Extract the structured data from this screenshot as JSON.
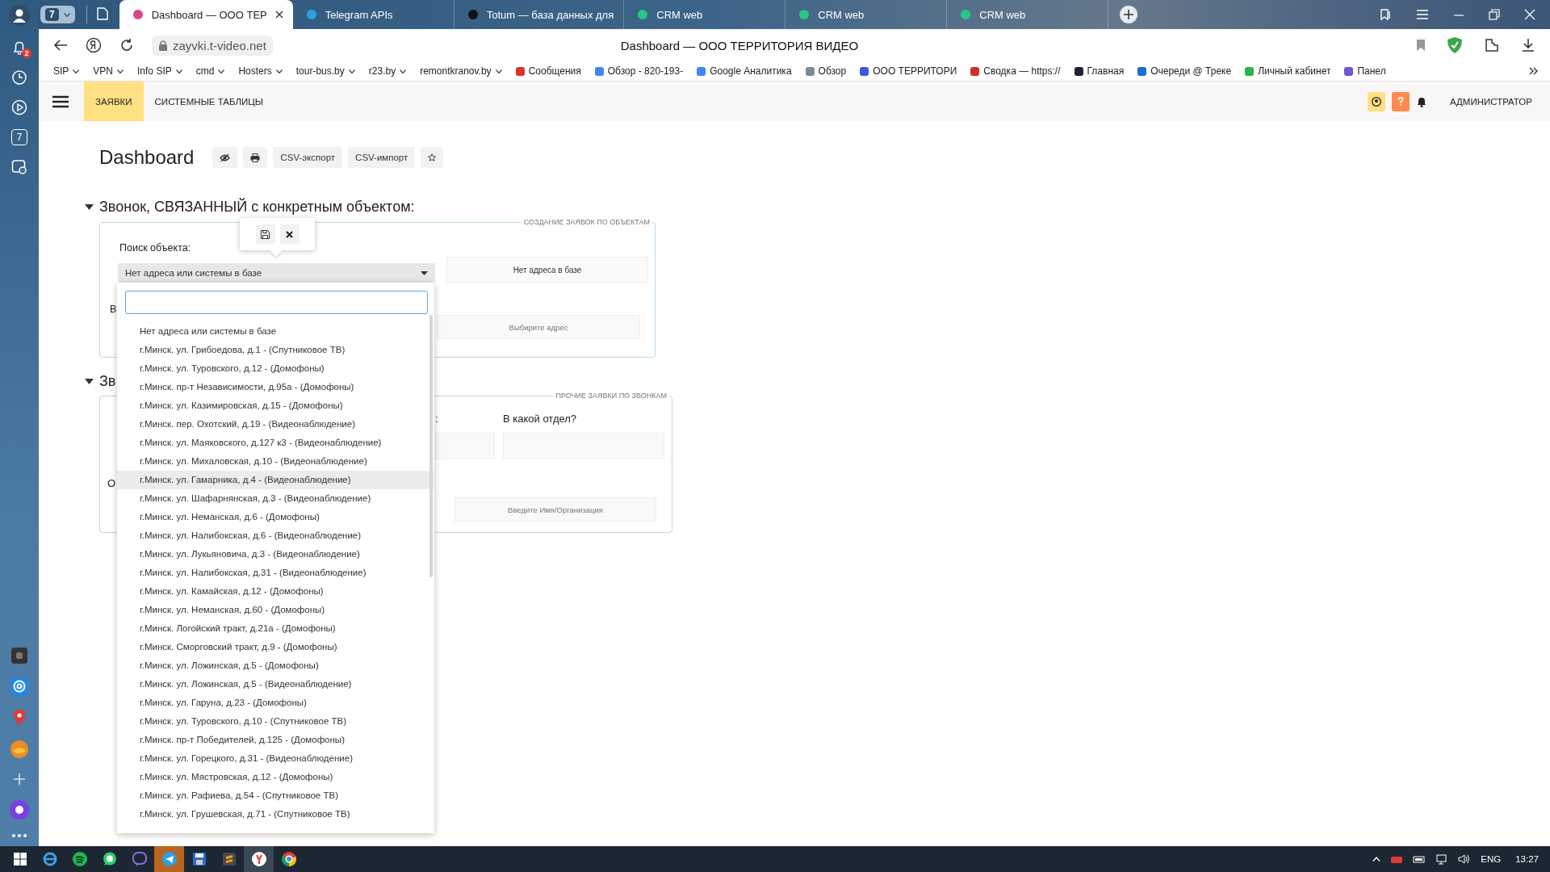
{
  "browser": {
    "tab_count": "7",
    "tabs": [
      {
        "title": "Dashboard — ООО ТЕР",
        "selected": true,
        "color": "#d9458f"
      },
      {
        "title": "Telegram APIs",
        "selected": false,
        "color": "#2aa3e0"
      },
      {
        "title": "Totum — база данных для",
        "selected": false,
        "color": "#111111"
      },
      {
        "title": "CRM web",
        "selected": false,
        "color": "#29c785"
      },
      {
        "title": "CRM web",
        "selected": false,
        "color": "#29c785"
      },
      {
        "title": "CRM web",
        "selected": false,
        "color": "#29c785"
      }
    ],
    "url": "zayvki.t-video.net",
    "page_title": "Dashboard — ООО ТЕРРИТОРИЯ ВИДЕО",
    "bookmarks": [
      {
        "label": "SIP",
        "kind": "folder"
      },
      {
        "label": "VPN",
        "kind": "folder"
      },
      {
        "label": "Info SIP",
        "kind": "folder"
      },
      {
        "label": "cmd",
        "kind": "folder"
      },
      {
        "label": "Hosters",
        "kind": "folder"
      },
      {
        "label": "tour-bus.by",
        "kind": "folder"
      },
      {
        "label": "r23.by",
        "kind": "folder"
      },
      {
        "label": "remontkranov.by",
        "kind": "folder"
      },
      {
        "label": "Сообщения",
        "kind": "link",
        "color": "#d8342c"
      },
      {
        "label": "Обзор - 820-193-",
        "kind": "link",
        "color": "#4285f4"
      },
      {
        "label": "Google Аналитика",
        "kind": "link",
        "color": "#4285f4"
      },
      {
        "label": "Обзор",
        "kind": "link",
        "color": "#7a8a9a"
      },
      {
        "label": "ООО ТЕРРИТОРИ",
        "kind": "link",
        "color": "#3b5bd6"
      },
      {
        "label": "Сводка — https://",
        "kind": "link",
        "color": "#c8332b"
      },
      {
        "label": "Главная",
        "kind": "link",
        "color": "#222233"
      },
      {
        "label": "Очереди @ Треке",
        "kind": "link",
        "color": "#1a6fd6"
      },
      {
        "label": "Личный кабинет",
        "kind": "link",
        "color": "#2bb24c"
      },
      {
        "label": "Панел",
        "kind": "link",
        "color": "#6a5acd"
      }
    ]
  },
  "sidebar": {
    "notifications": "2",
    "calendar_day": "7"
  },
  "app": {
    "nav": [
      {
        "label": "ЗАЯВКИ",
        "selected": true
      },
      {
        "label": "СИСТЕМНЫЕ ТАБЛИЦЫ",
        "selected": false
      }
    ],
    "user": "АДМИНИСТРАТОР"
  },
  "page": {
    "title": "Dashboard",
    "toolbar": [
      "CSV-экспорт",
      "CSV-импорт"
    ]
  },
  "section_1": {
    "heading": "Звонок, СВЯЗАННЫЙ с конкретным объектом:",
    "expanded": true,
    "legend": "СОЗДАНИЕ ЗАЯВОК ПО ОБЪЕКТАМ",
    "search_label": "Поиск объекта:",
    "select_value": "Нет адреса или системы в базе",
    "no_address_button": "Нет адреса в базе",
    "label_2": "В",
    "address_field": {
      "placeholder": "Выбирите адрес"
    }
  },
  "section_2": {
    "heading": "Зв",
    "expanded": true,
    "legend": "ПРОЧИЕ ЗАЯВКИ ПО ЗВОНКАМ",
    "label_1": ":",
    "department_label": "В какой отдел?",
    "label_3": "О",
    "name_field": {
      "placeholder": "Введите Имя/Организация"
    }
  },
  "dropdown": {
    "items": [
      {
        "label": "Нет адреса или системы в базе",
        "highlighted": false
      },
      {
        "label": "г.Минск. ул. Грибоедова, д.1 - (Спутниковое ТВ)",
        "highlighted": false
      },
      {
        "label": "г.Минск. ул. Туровского, д.12 - (Домофоны)",
        "highlighted": false
      },
      {
        "label": "г.Минск. пр-т Независимости, д.95а - (Домофоны)",
        "highlighted": false
      },
      {
        "label": "г.Минск. ул. Казимировская, д.15 - (Домофоны)",
        "highlighted": false
      },
      {
        "label": "г.Минск. пер. Охотский, д.19 - (Видеонаблюдение)",
        "highlighted": false
      },
      {
        "label": "г.Минск. ул. Маяковского, д.127 к3 - (Видеонаблюдение)",
        "highlighted": false
      },
      {
        "label": "г.Минск. ул. Михаловская, д.10 - (Видеонаблюдение)",
        "highlighted": false
      },
      {
        "label": "г.Минск. ул. Гамарника, д.4 - (Видеонаблюдение)",
        "highlighted": true
      },
      {
        "label": "г.Минск. ул. Шафарнянская, д.3 - (Видеонаблюдение)",
        "highlighted": false
      },
      {
        "label": "г.Минск. ул. Неманская, д.6 - (Домофоны)",
        "highlighted": false
      },
      {
        "label": "г.Минск. ул. Налибокская, д.6 - (Видеонаблюдение)",
        "highlighted": false
      },
      {
        "label": "г.Минск. ул. Лукьяновича, д.3 - (Видеонаблюдение)",
        "highlighted": false
      },
      {
        "label": "г.Минск. ул. Налибокская, д.31 - (Видеонаблюдение)",
        "highlighted": false
      },
      {
        "label": "г.Минск. ул. Камайская, д.12 - (Домофоны)",
        "highlighted": false
      },
      {
        "label": "г.Минск. ул. Неманская, д.60 - (Домофоны)",
        "highlighted": false
      },
      {
        "label": "г.Минск. Логойский тракт, д.21а - (Домофоны)",
        "highlighted": false
      },
      {
        "label": "г.Минск. Сморговский тракт, д.9 - (Домофоны)",
        "highlighted": false
      },
      {
        "label": "г.Минск. ул. Ложинская, д.5 - (Домофоны)",
        "highlighted": false
      },
      {
        "label": "г.Минск. ул. Ложинская, д.5 - (Видеонаблюдение)",
        "highlighted": false
      },
      {
        "label": "г.Минск. ул. Гаруна, д.23 - (Домофоны)",
        "highlighted": false
      },
      {
        "label": "г.Минск. ул. Туровского, д.10 - (Спутниковое ТВ)",
        "highlighted": false
      },
      {
        "label": "г.Минск. пр-т Победителей, д.125 - (Домофоны)",
        "highlighted": false
      },
      {
        "label": "г.Минск. ул. Горецкого, д.31 - (Видеонаблюдение)",
        "highlighted": false
      },
      {
        "label": "г.Минск. ул. Мястровская, д.12 - (Домофоны)",
        "highlighted": false
      },
      {
        "label": "г.Минск. ул. Рафиева, д.54 - (Спутниковое ТВ)",
        "highlighted": false
      },
      {
        "label": "г.Минск. ул. Грушевская, д.71 - (Спутниковое ТВ)",
        "highlighted": false
      }
    ]
  },
  "taskbar": {
    "language": "ENG",
    "time": "13:27"
  }
}
